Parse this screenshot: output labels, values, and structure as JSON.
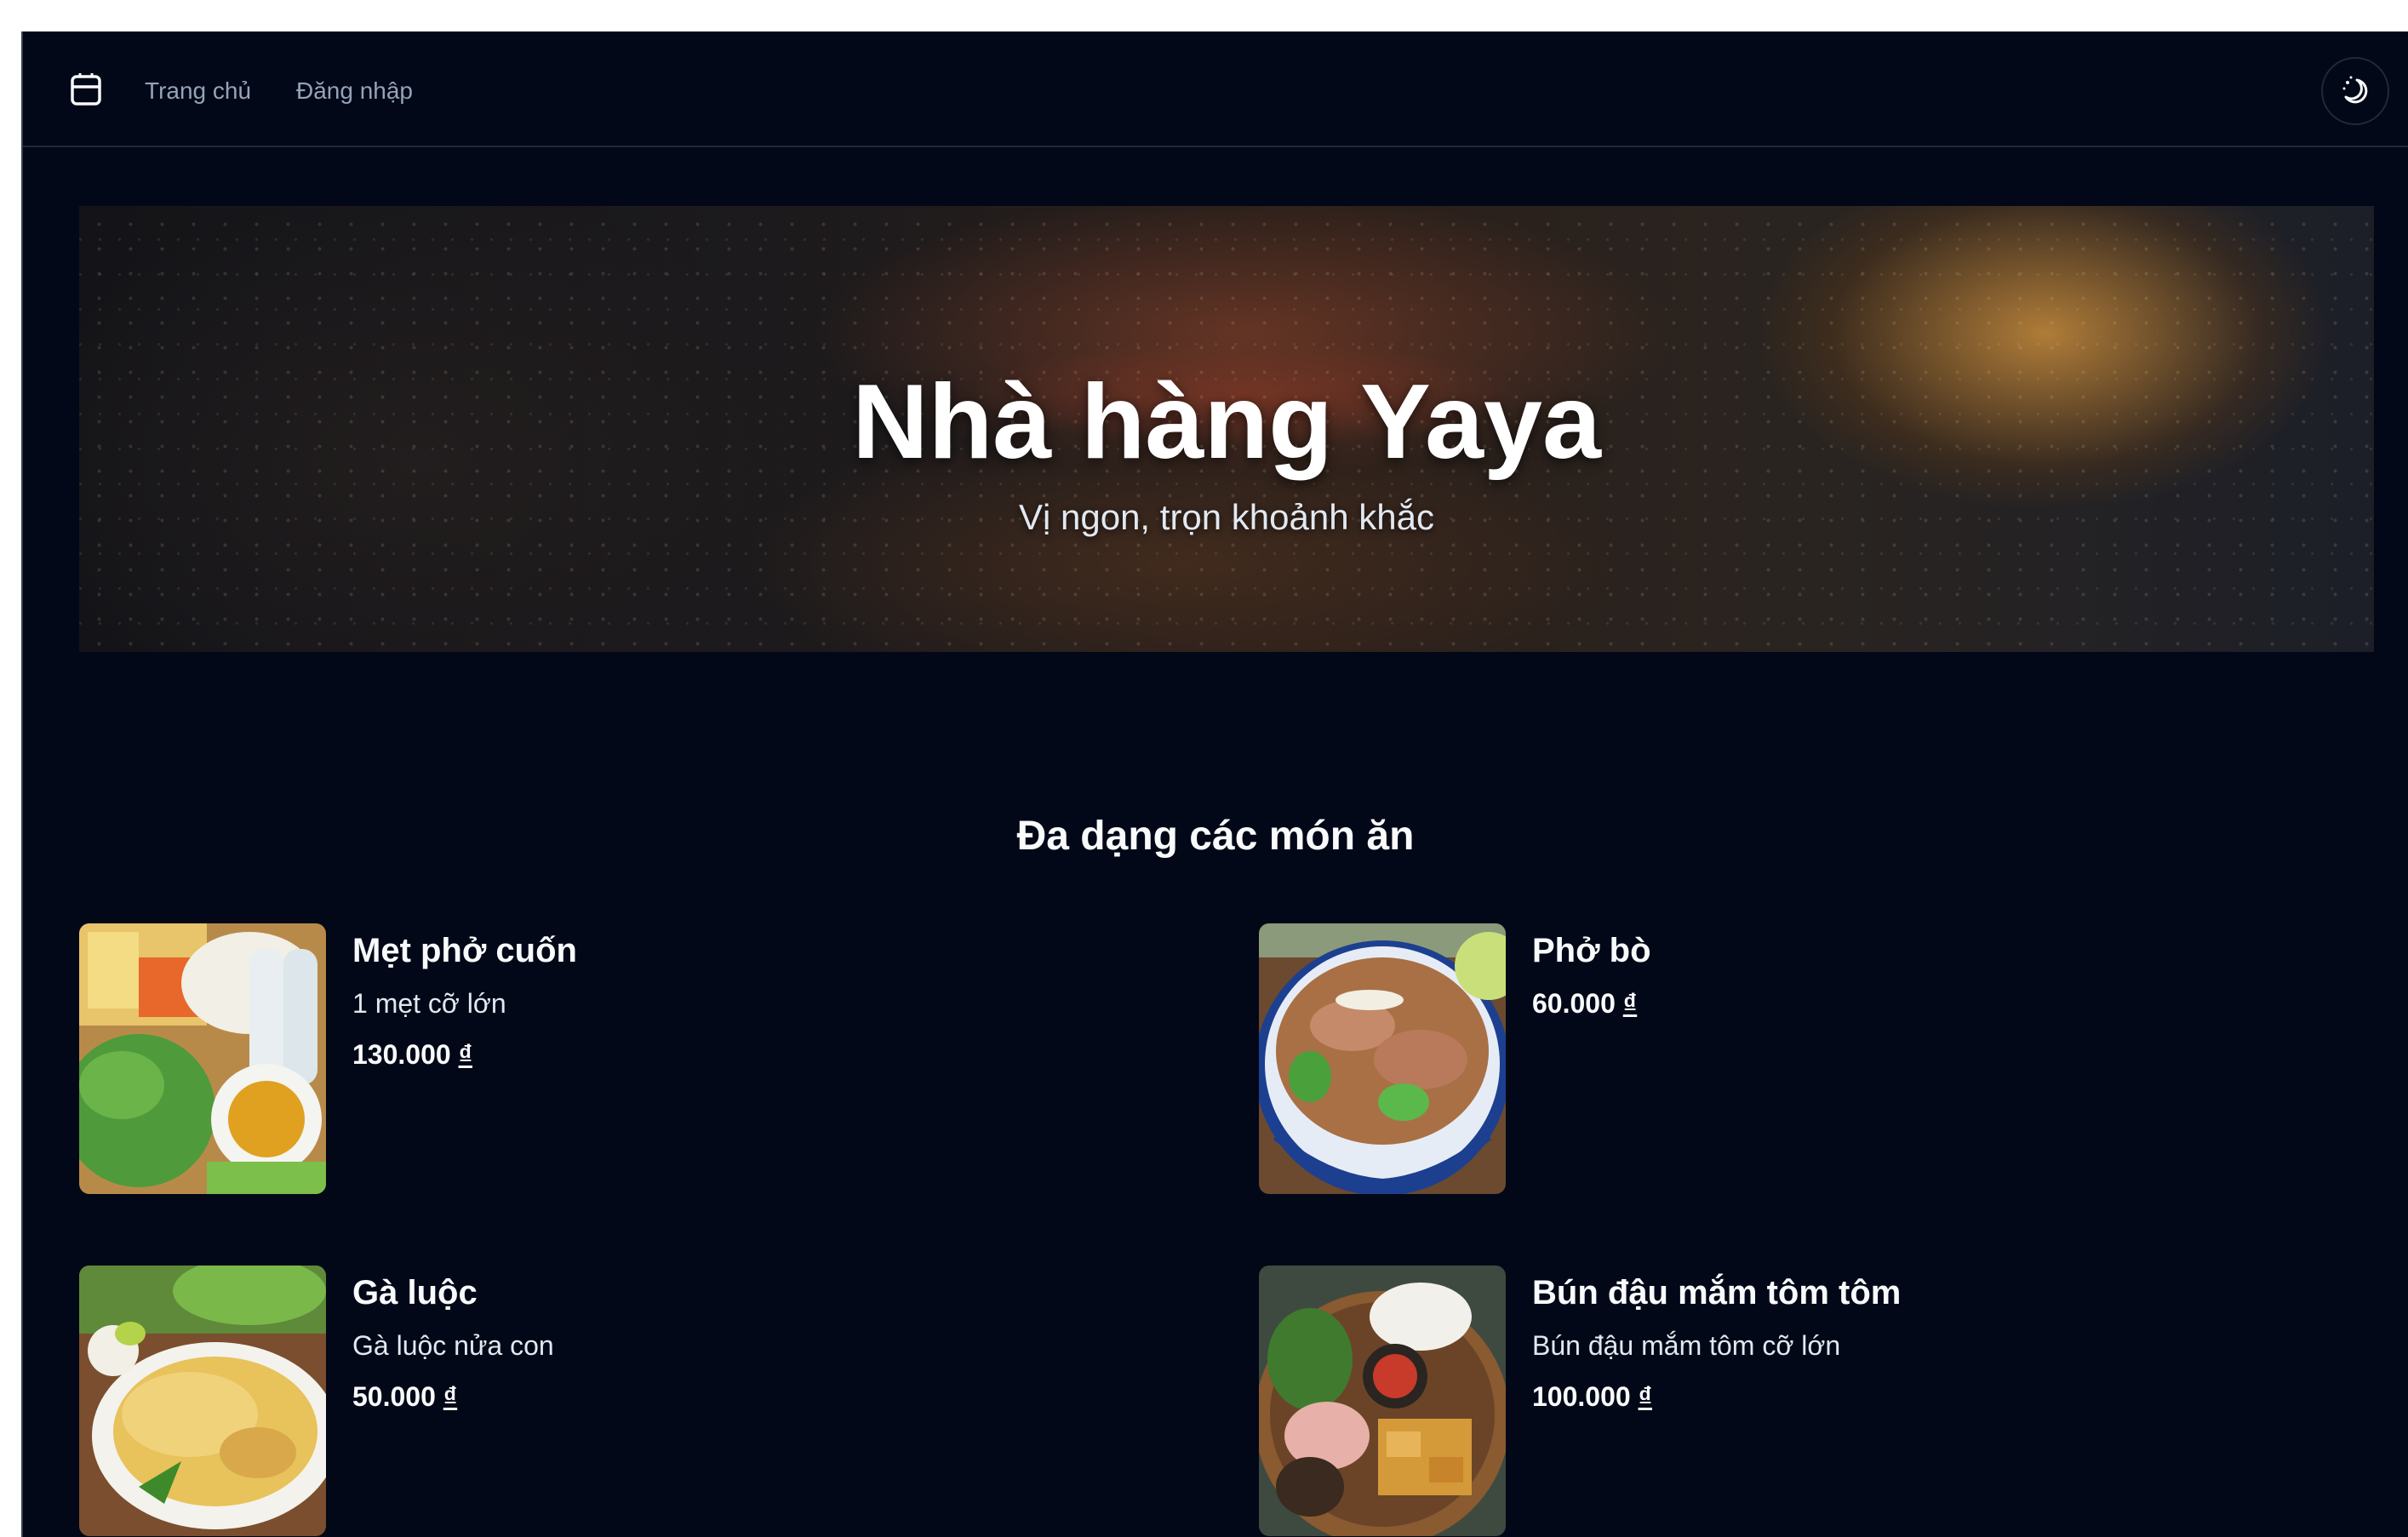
{
  "header": {
    "logo_icon": "shopping-bag-icon",
    "nav": [
      {
        "label": "Trang chủ"
      },
      {
        "label": "Đăng nhập"
      }
    ],
    "theme_toggle_icon": "moon-icon"
  },
  "hero": {
    "title": "Nhà hàng Yaya",
    "subtitle": "Vị ngon, trọn khoảnh khắc"
  },
  "menu": {
    "title": "Đa dạng các món ăn",
    "dishes": [
      {
        "name": "Mẹt phở cuốn",
        "description": "1 mẹt cỡ lớn",
        "price": "130.000",
        "currency": "₫"
      },
      {
        "name": "Phở bò",
        "description": "",
        "price": "60.000",
        "currency": "₫"
      },
      {
        "name": "Gà luộc",
        "description": "Gà luộc nửa con",
        "price": "50.000",
        "currency": "₫"
      },
      {
        "name": "Bún đậu mắm tôm tôm",
        "description": "Bún đậu mắm tôm cỡ lớn",
        "price": "100.000",
        "currency": "₫"
      }
    ]
  },
  "colors": {
    "background": "#020817",
    "muted_text": "#94a3b8",
    "text": "#f8fafc",
    "border": "#1e293b"
  }
}
